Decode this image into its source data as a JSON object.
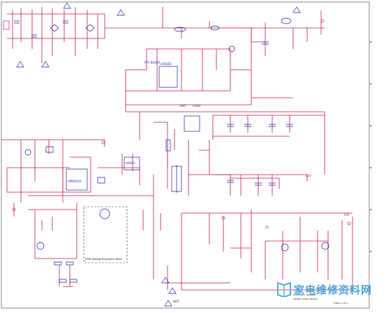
{
  "schematic": {
    "colors": {
      "wire": "#c8184a",
      "component": "#1a1aa8",
      "border": "#333333",
      "watermark": "#4fa3d8",
      "background": "#ffffff"
    },
    "labels": {
      "section_pfc": "PFC BLOCK",
      "hot_top": "HOT",
      "cold_top": "COLD",
      "hot_bottom": "HOT",
      "standby_box": "STBY Voltage Regulation Block",
      "ic_main": "L6562D",
      "ic_standby": "VIPER22A",
      "ic_mid": "LM393",
      "out_12v": "12V",
      "out_24v": "24V",
      "out_5v": "5V"
    },
    "watermark": {
      "text": "家电维修资料网",
      "logo": "book-logo-icon"
    },
    "title_block": {
      "line1": "SCHEMATIC DIAGRAM",
      "line2": "POWER SUPPLY BOARD",
      "line3": "SHEET 1 OF 1"
    }
  }
}
